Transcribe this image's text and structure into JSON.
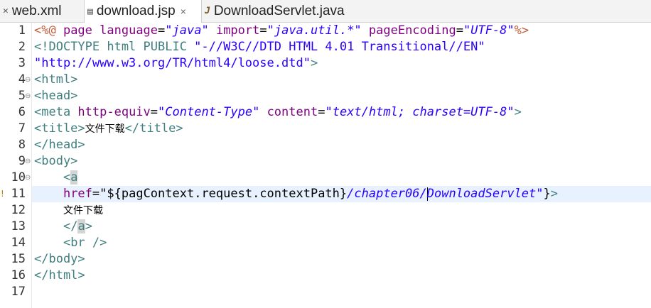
{
  "tabs": [
    {
      "label": "web.xml",
      "icon": "xml-file-icon",
      "active": false
    },
    {
      "label": "download.jsp",
      "icon": "jsp-file-icon",
      "active": true,
      "close": "×"
    },
    {
      "label": "DownloadServlet.java",
      "icon": "java-file-icon",
      "active": false
    }
  ],
  "line_numbers": [
    "1",
    "2",
    "3",
    "4",
    "5",
    "6",
    "7",
    "8",
    "9",
    "10",
    "11",
    "12",
    "13",
    "14",
    "15",
    "16",
    "17"
  ],
  "fold_marker": "⊖",
  "warning_marker": "!",
  "code": {
    "l1": [
      "<%@ ",
      "page ",
      "language",
      "=",
      "\"java\" ",
      "import",
      "=",
      "\"java.util.*\" ",
      "pageEncoding",
      "=",
      "\"UTF-8\"",
      "%>"
    ],
    "l2": [
      "<!DOCTYPE html PUBLIC ",
      "\"-//W3C//DTD HTML 4.01 Transitional//EN\""
    ],
    "l3": [
      "\"http://www.w3.org/TR/html4/loose.dtd\"",
      ">"
    ],
    "l4": [
      "<html>"
    ],
    "l5": [
      "<head>"
    ],
    "l6": [
      "<meta ",
      "http-equiv",
      "=",
      "\"Content-Type\" ",
      "content",
      "=",
      "\"text/html; charset=UTF-8\"",
      ">"
    ],
    "l7": [
      "<title>",
      "文件下载",
      "</title>"
    ],
    "l8": [
      "</head>"
    ],
    "l9": [
      "<body>"
    ],
    "l10": [
      "    ",
      "<",
      "a"
    ],
    "l11": [
      "    ",
      "href",
      "=",
      "\"${pagContext.request.contextPath}",
      "/chapter06/",
      "DownloadServlet\"",
      "}",
      ">"
    ],
    "l12": [
      "    ",
      "文件下载"
    ],
    "l13": [
      "    ",
      "</",
      "a",
      ">"
    ],
    "l14": [
      "    ",
      "<br />"
    ],
    "l15": [
      "</body>"
    ],
    "l16": [
      "</html>"
    ],
    "l17": [
      ""
    ]
  }
}
